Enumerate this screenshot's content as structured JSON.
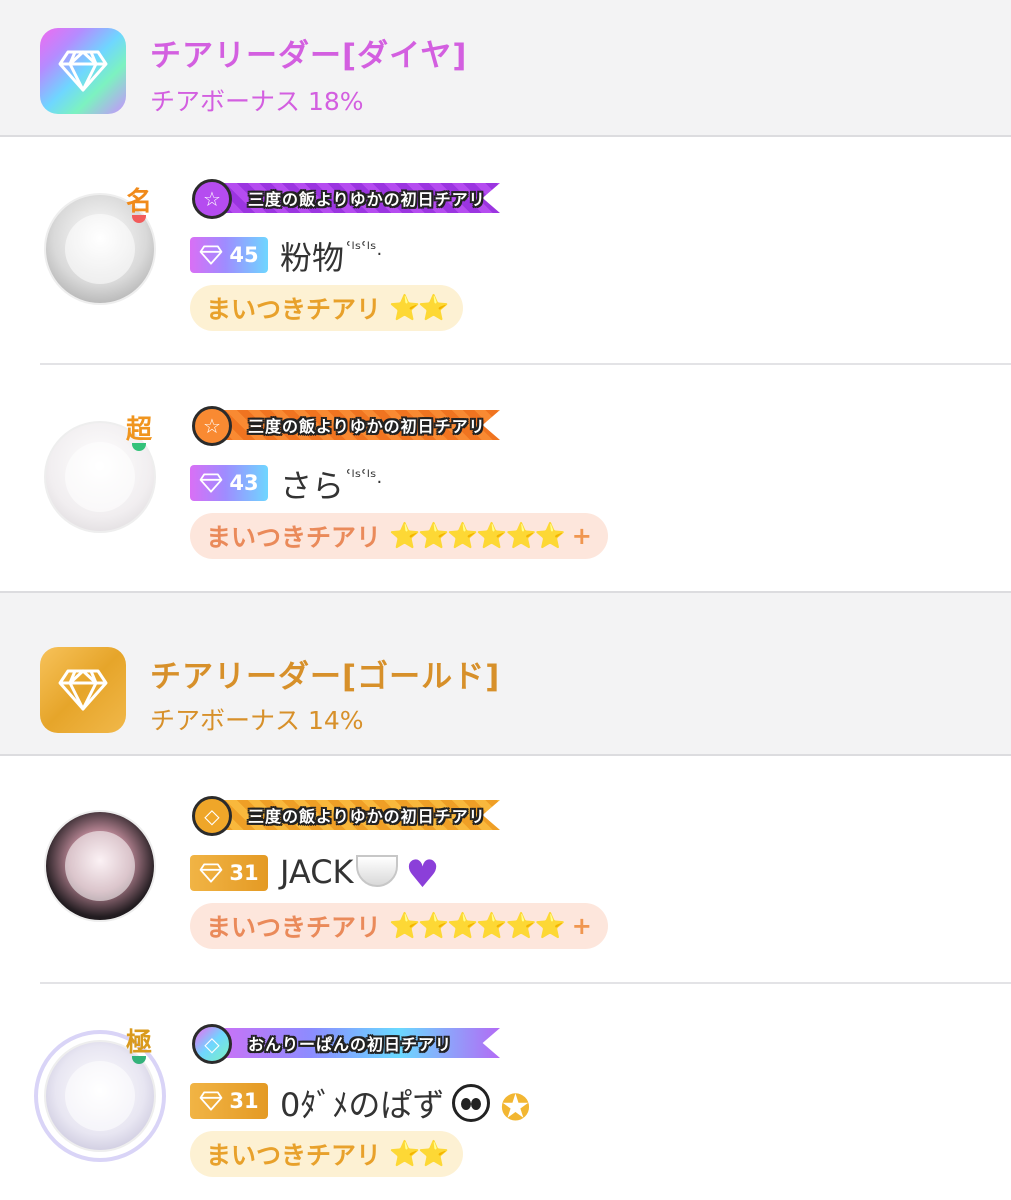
{
  "sections": [
    {
      "tier": "diamond",
      "title": "チアリーダー[ダイヤ]",
      "bonus": "チアボーナス 18%",
      "icon": "diamond-icon",
      "color": "#d35fe0",
      "users": [
        {
          "rank_badge": "名",
          "ribbon_text": "三度の飯よりゆかの初日チアリ",
          "ribbon_icon": "star-icon",
          "level": "45",
          "name": "粉物",
          "name_suffix": "ʿˡˢʿˡˢ.",
          "cheer_label": "まいつきチアリ",
          "cheer_stars": "⭐⭐",
          "cheer_plus": ""
        },
        {
          "rank_badge": "超",
          "ribbon_text": "三度の飯よりゆかの初日チアリ",
          "ribbon_icon": "star-icon",
          "level": "43",
          "name": "さら",
          "name_suffix": "ʿˡˢʿˡˢ.",
          "cheer_label": "まいつきチアリ",
          "cheer_stars": "⭐⭐⭐⭐⭐⭐",
          "cheer_plus": "+"
        }
      ]
    },
    {
      "tier": "gold",
      "title": "チアリーダー[ゴールド]",
      "bonus": "チアボーナス 14%",
      "icon": "diamond-icon",
      "color": "#d7902a",
      "users": [
        {
          "rank_badge": "",
          "ribbon_text": "三度の飯よりゆかの初日チアリ",
          "ribbon_icon": "diamond-icon",
          "level": "31",
          "name": "JACK",
          "name_suffix": "",
          "cheer_label": "まいつきチアリ",
          "cheer_stars": "⭐⭐⭐⭐⭐⭐",
          "cheer_plus": "+"
        },
        {
          "rank_badge": "極",
          "ribbon_text": "おんりーぱんの初日チアリ",
          "ribbon_icon": "diamond-icon",
          "level": "31",
          "name": "0ﾀﾞﾒのぱず",
          "name_suffix": "",
          "cheer_label": "まいつきチアリ",
          "cheer_stars": "⭐⭐",
          "cheer_plus": ""
        }
      ]
    }
  ],
  "colors": {
    "diamond_accent": "#d35fe0",
    "gold_accent": "#d7902a",
    "header_bg": "#f3f3f4"
  }
}
